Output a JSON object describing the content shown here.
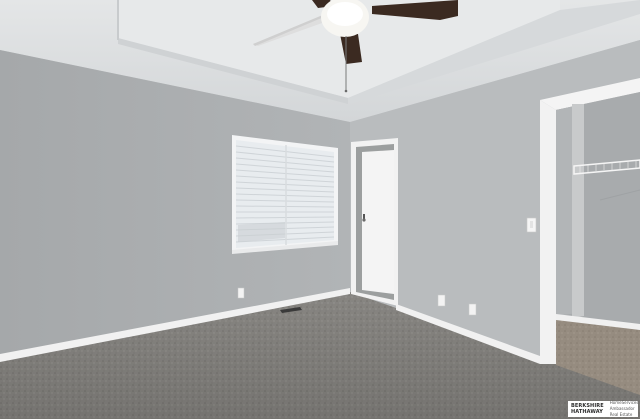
{
  "scene": {
    "description_free": true,
    "colors": {
      "ceiling": "#dcdedf",
      "left_wall": "#aeb1b3",
      "back_wall": "#b7babc",
      "right_wall": "#b8bbbd",
      "carpet": "#8e8c88",
      "trim": "#f2f2f2",
      "fan_blade": "#3a2a22",
      "window_light": "#e9eef3"
    }
  },
  "watermark": {
    "brand_line1": "BERKSHIRE",
    "brand_line2": "HATHAWAY",
    "sub_line1": "HomeServices",
    "sub_line2": "Ambassador Real Estate"
  }
}
